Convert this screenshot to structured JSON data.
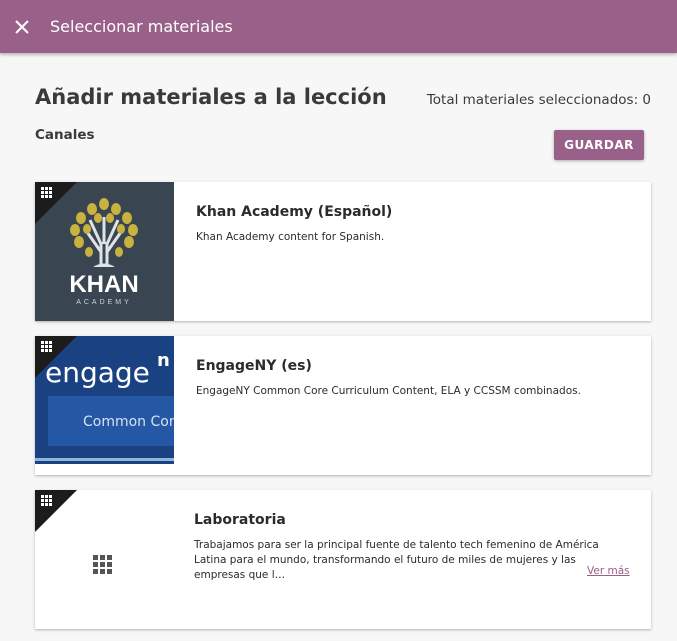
{
  "appbar": {
    "title": "Seleccionar materiales",
    "close_icon": "close-icon",
    "background": "#996189"
  },
  "header": {
    "title": "Añadir materiales a la lección",
    "total_label": "Total materiales seleccionados: 0",
    "section_label": "Canales",
    "save_label": "GUARDAR"
  },
  "channels": [
    {
      "title": "Khan Academy (Español)",
      "description": "Khan Academy content for Spanish.",
      "logo_text": "KHAN",
      "logo_subtext": "ACADEMY"
    },
    {
      "title": "EngageNY (es)",
      "description": "EngageNY Common Core Curriculum Content, ELA y CCSSM combinados.",
      "logo_text": "engage",
      "logo_text_cut": "n",
      "logo_subtext": "Common Cor"
    },
    {
      "title": "Laboratoria",
      "description": "Trabajamos para ser la principal fuente de talento tech femenino de América Latina para el mundo, transformando el futuro de miles de mujeres y las empresas que l…",
      "more_link": "Ver más",
      "thumb_icon": "apps-grid-icon"
    }
  ],
  "colors": {
    "accent": "#996189",
    "khan_bg": "#394551",
    "engage_blue": "#1a4283"
  }
}
